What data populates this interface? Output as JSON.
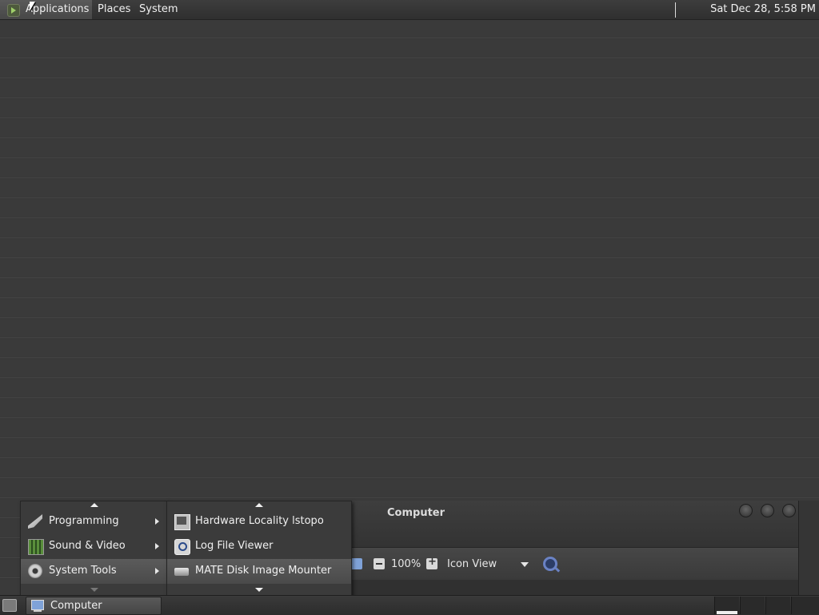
{
  "top_panel": {
    "menus": [
      {
        "label": "Applications"
      },
      {
        "label": "Places"
      },
      {
        "label": "System"
      }
    ],
    "clock": "Sat Dec 28,  5:58 PM"
  },
  "applications_menu": {
    "items": [
      {
        "label": "Programming",
        "icon": "programming-icon"
      },
      {
        "label": "Sound & Video",
        "icon": "sound-video-icon"
      },
      {
        "label": "System Tools",
        "icon": "gear-icon",
        "active": true
      }
    ]
  },
  "system_tools_menu": {
    "items": [
      {
        "label": "Hardware Locality lstopo",
        "icon": "hardware-icon"
      },
      {
        "label": "Log File Viewer",
        "icon": "log-viewer-icon"
      },
      {
        "label": "MATE Disk Image Mounter",
        "icon": "disk-icon",
        "active": true
      }
    ]
  },
  "file_manager": {
    "title": "Computer",
    "zoom": "100%",
    "view_mode": "Icon View"
  },
  "bottom_panel": {
    "task_label": "Computer"
  },
  "colors": {
    "panel": "#2f2f2f",
    "menu_bg": "#3b3b3b",
    "highlight": "#505050"
  }
}
